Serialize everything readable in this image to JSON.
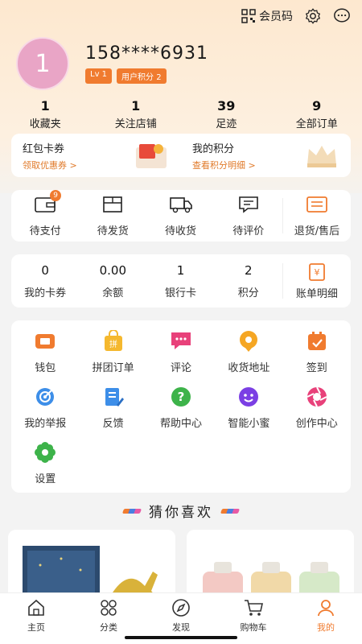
{
  "topbar": {
    "member_code": "会员码"
  },
  "profile": {
    "avatar_text": "1",
    "phone": "158****6931",
    "level": "Lv 1",
    "points_badge": "用户积分 2"
  },
  "stats": [
    {
      "num": "1",
      "label": "收藏夹"
    },
    {
      "num": "1",
      "label": "关注店铺"
    },
    {
      "num": "39",
      "label": "足迹"
    },
    {
      "num": "9",
      "label": "全部订单"
    }
  ],
  "wallet": {
    "left_title": "红包卡券",
    "left_link": "领取优惠券 >",
    "right_title": "我的积分",
    "right_link": "查看积分明细 >"
  },
  "orders": {
    "pay": "待支付",
    "pay_count": "9",
    "ship": "待发货",
    "receive": "待收货",
    "review": "待评价",
    "refund": "退货/售后"
  },
  "assets": [
    {
      "num": "0",
      "label": "我的卡券"
    },
    {
      "num": "0.00",
      "label": "余额"
    },
    {
      "num": "1",
      "label": "银行卡"
    },
    {
      "num": "2",
      "label": "积分"
    }
  ],
  "assets_bill": "账单明细",
  "tools": {
    "wallet": "钱包",
    "group": "拼团订单",
    "comment": "评论",
    "address": "收货地址",
    "checkin": "签到",
    "report": "我的举报",
    "feedback": "反馈",
    "help": "帮助中心",
    "assistant": "智能小蜜",
    "creator": "创作中心",
    "settings": "设置"
  },
  "guess": "猜你喜欢",
  "tabs": {
    "home": "主页",
    "category": "分类",
    "discover": "发现",
    "cart": "购物车",
    "mine": "我的"
  },
  "colors": {
    "accent": "#f07b2f",
    "avatar": "#e9a5c6"
  }
}
